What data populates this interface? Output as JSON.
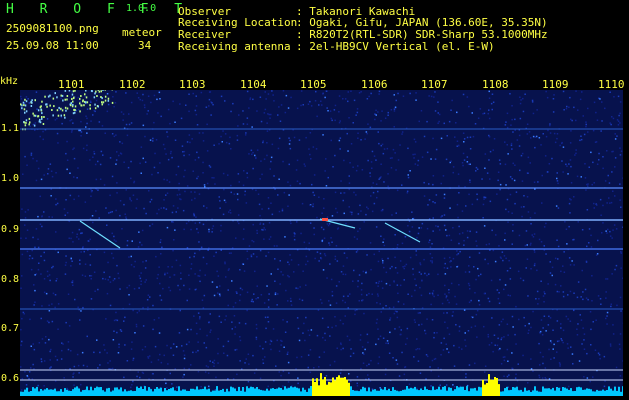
{
  "header": {
    "brand": "H R O F F T",
    "version": "1.0.0",
    "filename": "2509081100.png",
    "datetime": "25.09.08 11:00",
    "meteor_label": "meteor",
    "meteor_count": "34",
    "info": [
      {
        "label": "Observer",
        "value": ": Takanori Kawachi"
      },
      {
        "label": "Receiving Location",
        "value": ": Ogaki, Gifu, JAPAN (136.60E, 35.35N)"
      },
      {
        "label": "Receiver",
        "value": ": R820T2(RTL-SDR) SDR-Sharp 53.1000MHz"
      },
      {
        "label": "Receiving antenna",
        "value": ": 2el-HB9CV Vertical (el. E-W)"
      }
    ]
  },
  "axis": {
    "unit": "kHz",
    "time_ticks": [
      "1101",
      "1102",
      "1103",
      "1104",
      "1105",
      "1106",
      "1107",
      "1108",
      "1109",
      "1110"
    ],
    "freq_ticks": [
      "1.1",
      "1.0",
      "0.9",
      "0.8",
      "0.7",
      "0.6"
    ]
  },
  "colors": {
    "label_yellow": "#ffff44",
    "label_green": "#44ff44",
    "background_noise": "#0a1a6a",
    "signal_line": "#7fb0ff",
    "level_bar": "#00c8ff",
    "level_peak": "#ffff00"
  }
}
